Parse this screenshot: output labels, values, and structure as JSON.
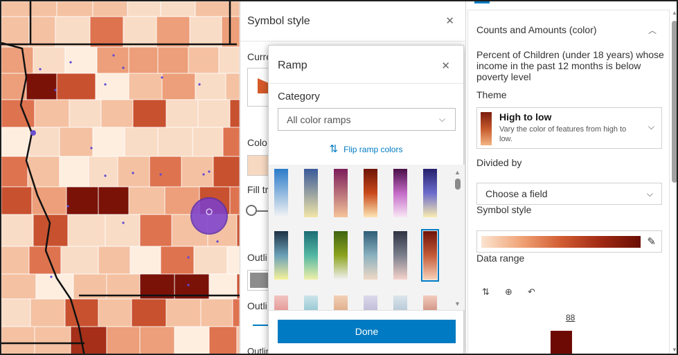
{
  "symbol_style": {
    "title": "Symbol style",
    "close_icon": "close-icon",
    "current_label": "Curre",
    "color_label": "Colo",
    "fill_label": "Fill tr",
    "outline_color_label": "Outli",
    "outline_label": "Outli",
    "outline_width_label": "Outline width"
  },
  "ramp_dialog": {
    "title": "Ramp",
    "category_label": "Category",
    "category_value": "All color ramps",
    "flip_label": "Flip ramp colors",
    "done_label": "Done",
    "ramps": [
      [
        "#f4f4f4",
        "#2b7bc9"
      ],
      [
        "#f2e6a7",
        "#3a5a9a"
      ],
      [
        "#f5c49a",
        "#7b1e5a"
      ],
      [
        "#fde6b4",
        "#c9491b",
        "#6e1508"
      ],
      [
        "#f9e7f5",
        "#c46bc7",
        "#4a0f48"
      ],
      [
        "#f9ecb0",
        "#6b6bcc",
        "#25216d"
      ],
      [
        "#f6f29a",
        "#6aa0b7",
        "#1e3144"
      ],
      [
        "#f0f0a8",
        "#52b7a3",
        "#1c6c74"
      ],
      [
        "#f2f2f2",
        "#8ca31e",
        "#3f6312"
      ],
      [
        "#f0d8c5",
        "#8ab1bf",
        "#2f5d78"
      ],
      [
        "#f6d3cc",
        "#7a7f8c",
        "#2f3342"
      ],
      [
        "#f6d2b9",
        "#c45b38",
        "#6e1108"
      ],
      [
        "#c9423a",
        "#f1c4c2"
      ],
      [
        "#2b8fa7",
        "#cce4e9"
      ],
      [
        "#b5662a",
        "#f3d0b7"
      ],
      [
        "#8a80b3",
        "#dcd9ea"
      ],
      [
        "#6b8ea8",
        "#dbe5ec"
      ],
      [
        "#8c2414",
        "#f2cbbd"
      ]
    ]
  },
  "right_panel": {
    "section_title": "Counts and Amounts (color)",
    "description": "Percent of Children (under 18 years) whose income in the past 12 months is below poverty level",
    "theme_label": "Theme",
    "theme_title": "High to low",
    "theme_subtitle": "Vary the color of features from high to low.",
    "divided_by_label": "Divided by",
    "divided_by_value": "Choose a field",
    "symbol_style_label": "Symbol style",
    "data_range_label": "Data range",
    "data_range_max": "88"
  },
  "colors": {
    "accent": "#007ac2",
    "dark_red": "#6e0a04"
  }
}
